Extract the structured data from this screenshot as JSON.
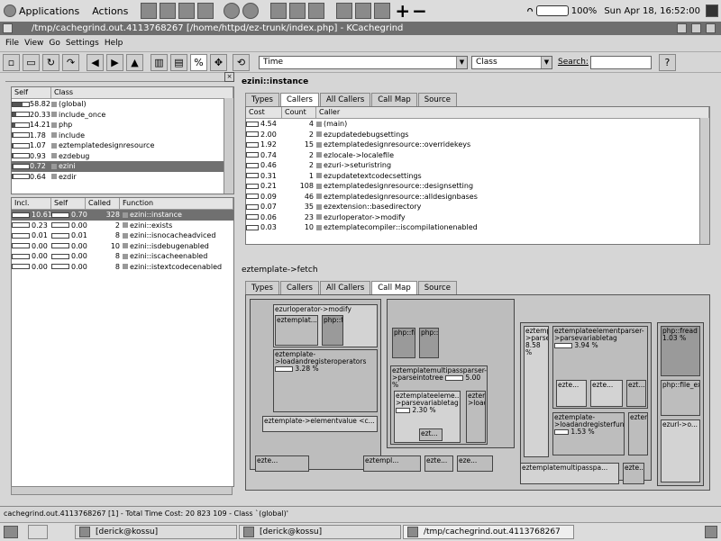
{
  "top_panel": {
    "applications": "Applications",
    "actions": "Actions",
    "battery": "100%",
    "clock": "Sun Apr 18, 16:52:00"
  },
  "window": {
    "title": "/tmp/cachegrind.out.4113768267 [/home/httpd/ez-trunk/index.php] - KCachegrind"
  },
  "menu": [
    "File",
    "View",
    "Go",
    "Settings",
    "Help"
  ],
  "toolbar": {
    "percent": "%",
    "event_type": "Time",
    "group_type": "Class",
    "search_label": "Search:",
    "search_value": ""
  },
  "class_list": {
    "headers": [
      "Self",
      "Class"
    ],
    "rows": [
      {
        "self": "58.82",
        "name": "(global)",
        "fill": 0.59
      },
      {
        "self": "20.33",
        "name": "include_once",
        "fill": 0.2
      },
      {
        "self": "14.21",
        "name": "php",
        "fill": 0.14
      },
      {
        "self": "1.78",
        "name": "include",
        "fill": 0.02
      },
      {
        "self": "1.07",
        "name": "eztemplatedesignresource",
        "fill": 0.01
      },
      {
        "self": "0.93",
        "name": "ezdebug",
        "fill": 0.01
      },
      {
        "self": "0.72",
        "name": "ezini",
        "fill": 0.01,
        "selected": true
      },
      {
        "self": "0.64",
        "name": "ezdir",
        "fill": 0.01
      }
    ]
  },
  "function_list": {
    "headers": [
      "Incl.",
      "Self",
      "Called",
      "Function"
    ],
    "rows": [
      {
        "incl": "10.61",
        "self": "0.70",
        "called": "328",
        "name": "ezini::instance",
        "selected": true
      },
      {
        "incl": "0.23",
        "self": "0.00",
        "called": "2",
        "name": "ezini::exists"
      },
      {
        "incl": "0.01",
        "self": "0.01",
        "called": "8",
        "name": "ezini::isnocacheadviced"
      },
      {
        "incl": "0.00",
        "self": "0.00",
        "called": "10",
        "name": "ezini::isdebugenabled"
      },
      {
        "incl": "0.00",
        "self": "0.00",
        "called": "8",
        "name": "ezini::iscacheenabled"
      },
      {
        "incl": "0.00",
        "self": "0.00",
        "called": "8",
        "name": "ezini::istextcodecenabled"
      }
    ]
  },
  "top_panel_view": {
    "function_name": "ezini::instance",
    "tabs": [
      "Types",
      "Callers",
      "All Callers",
      "Call Map",
      "Source"
    ],
    "active_tab": "Callers",
    "headers": [
      "Cost",
      "Count",
      "Caller"
    ],
    "rows": [
      {
        "cost": "4.54",
        "count": "4",
        "caller": "(main)"
      },
      {
        "cost": "2.00",
        "count": "2",
        "caller": "ezupdatedebugsettings"
      },
      {
        "cost": "1.92",
        "count": "15",
        "caller": "eztemplatedesignresource::overridekeys"
      },
      {
        "cost": "0.74",
        "count": "2",
        "caller": "ezlocale->localefile"
      },
      {
        "cost": "0.46",
        "count": "2",
        "caller": "ezuri->seturistring"
      },
      {
        "cost": "0.31",
        "count": "1",
        "caller": "ezupdatetextcodecsettings"
      },
      {
        "cost": "0.21",
        "count": "108",
        "caller": "eztemplatedesignresource::designsetting"
      },
      {
        "cost": "0.09",
        "count": "46",
        "caller": "eztemplatedesignresource::alldesignbases"
      },
      {
        "cost": "0.07",
        "count": "35",
        "caller": "ezextension::basedirectory"
      },
      {
        "cost": "0.06",
        "count": "23",
        "caller": "ezurloperator->modify"
      },
      {
        "cost": "0.03",
        "count": "10",
        "caller": "eztemplatecompiler::iscompilationenabled"
      }
    ]
  },
  "bottom_panel_view": {
    "function_name": "eztemplate->fetch",
    "tabs": [
      "Types",
      "Callers",
      "All Callers",
      "Call Map",
      "Source"
    ],
    "active_tab": "Call Map",
    "treemap_labels": {
      "a": "ezurloperator->modify",
      "b": "eztemplat...",
      "c": "php::file_exists",
      "d": "eztemplate->loadandregisteroperators",
      "d_pct": "3.28 %",
      "e": "eztemplate->elementvalue <c...",
      "f": "php::fread",
      "g": "php::file...",
      "h": "eztemplatemultipassparser->parseintotree",
      "h_pct": "5.00 %",
      "i": "eztemplateeleme...->parsevariabletag",
      "i_pct": "2.30 %",
      "j": "ezt...",
      "k": "eztemplate->loadandregist...",
      "l": "eztemplatemultipassparser->parseintotree",
      "l_pct": "8.58 %",
      "m": "eztemplateelementparser->parsevariabletag",
      "m_pct": "3.94 %",
      "n": "ezte...",
      "o": "ezte...",
      "p": "ezt...",
      "q": "eztemplate->loadandregisterfun...",
      "q_pct": "1.53 %",
      "r": "eztempl...",
      "s": "eztemplatemultipasspa...",
      "t": "ezte...",
      "u": "php::fread",
      "u_pct": "1.03 %",
      "v": "php::file_exists",
      "w": "ezurl->o...",
      "x": "ezte...",
      "y": "eztempl...",
      "z": "ezte...",
      "aa": "eze..."
    }
  },
  "status": {
    "text": "cachegrind.out.4113768267 [1] - Total Time Cost:  20 823 109 - Class `(global)'"
  },
  "taskbar": {
    "items": [
      "[derick@kossu]",
      "[derick@kossu]",
      "/tmp/cachegrind.out.4113768267"
    ]
  }
}
